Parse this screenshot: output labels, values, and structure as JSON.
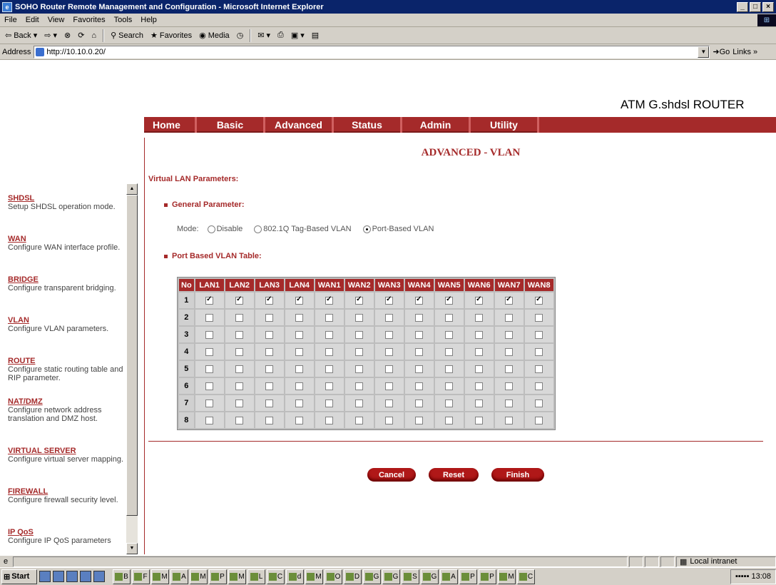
{
  "window": {
    "title": "SOHO Router Remote Management and Configuration - Microsoft Internet Explorer"
  },
  "menu": [
    "File",
    "Edit",
    "View",
    "Favorites",
    "Tools",
    "Help"
  ],
  "toolbar": {
    "back": "Back",
    "search": "Search",
    "favorites": "Favorites",
    "media": "Media"
  },
  "address": {
    "label": "Address",
    "url": "http://10.10.0.20/",
    "go": "Go",
    "links": "Links"
  },
  "product": "ATM G.shdsl ROUTER",
  "nav": [
    "Home",
    "Basic",
    "Advanced",
    "Status",
    "Admin",
    "Utility"
  ],
  "page_title": "ADVANCED - VLAN",
  "section_title": "Virtual LAN Parameters:",
  "general_param": "General Parameter:",
  "mode": {
    "label": "Mode:",
    "options": [
      "Disable",
      "802.1Q Tag-Based VLAN",
      "Port-Based VLAN"
    ],
    "selected": 2
  },
  "table_title": "Port Based VLAN Table:",
  "table": {
    "headers": [
      "No",
      "LAN1",
      "LAN2",
      "LAN3",
      "LAN4",
      "WAN1",
      "WAN2",
      "WAN3",
      "WAN4",
      "WAN5",
      "WAN6",
      "WAN7",
      "WAN8"
    ],
    "rows": [
      {
        "no": "1",
        "checked": [
          true,
          true,
          true,
          true,
          true,
          true,
          true,
          true,
          true,
          true,
          true,
          true
        ]
      },
      {
        "no": "2",
        "checked": [
          false,
          false,
          false,
          false,
          false,
          false,
          false,
          false,
          false,
          false,
          false,
          false
        ]
      },
      {
        "no": "3",
        "checked": [
          false,
          false,
          false,
          false,
          false,
          false,
          false,
          false,
          false,
          false,
          false,
          false
        ]
      },
      {
        "no": "4",
        "checked": [
          false,
          false,
          false,
          false,
          false,
          false,
          false,
          false,
          false,
          false,
          false,
          false
        ]
      },
      {
        "no": "5",
        "checked": [
          false,
          false,
          false,
          false,
          false,
          false,
          false,
          false,
          false,
          false,
          false,
          false
        ]
      },
      {
        "no": "6",
        "checked": [
          false,
          false,
          false,
          false,
          false,
          false,
          false,
          false,
          false,
          false,
          false,
          false
        ]
      },
      {
        "no": "7",
        "checked": [
          false,
          false,
          false,
          false,
          false,
          false,
          false,
          false,
          false,
          false,
          false,
          false
        ]
      },
      {
        "no": "8",
        "checked": [
          false,
          false,
          false,
          false,
          false,
          false,
          false,
          false,
          false,
          false,
          false,
          false
        ]
      }
    ]
  },
  "buttons": {
    "cancel": "Cancel",
    "reset": "Reset",
    "finish": "Finish"
  },
  "sidebar": [
    {
      "title": "SHDSL",
      "desc": "Setup SHDSL operation mode."
    },
    {
      "title": "WAN",
      "desc": "Configure WAN interface profile."
    },
    {
      "title": "BRIDGE",
      "desc": "Configure transparent bridging."
    },
    {
      "title": "VLAN",
      "desc": "Configure VLAN parameters."
    },
    {
      "title": "ROUTE",
      "desc": "Configure static routing table and RIP parameter."
    },
    {
      "title": "NAT/DMZ",
      "desc": "Configure network address translation and DMZ host."
    },
    {
      "title": "VIRTUAL SERVER",
      "desc": "Configure virtual server mapping."
    },
    {
      "title": "FIREWALL",
      "desc": "Configure firewall security level."
    },
    {
      "title": "IP QoS",
      "desc": "Configure IP QoS parameters"
    }
  ],
  "status": {
    "zone": "Local intranet"
  },
  "taskbar": {
    "start": "Start",
    "clock": "13:08",
    "items": [
      "B",
      "F",
      "M",
      "A",
      "M",
      "P",
      "M",
      "L",
      "C",
      "d",
      "M",
      "O",
      "D",
      "G",
      "G",
      "S",
      "G",
      "A",
      "P",
      "P",
      "M",
      "C"
    ]
  },
  "colors": {
    "accent": "#a52a2a",
    "titlebar": "#0a246a"
  }
}
